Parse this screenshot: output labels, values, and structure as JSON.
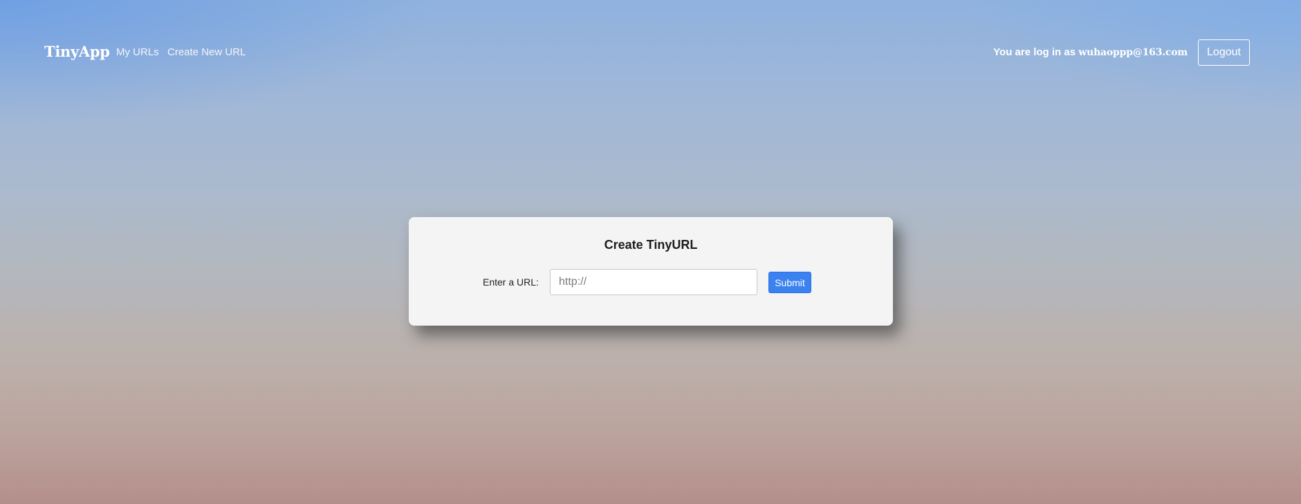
{
  "navbar": {
    "brand": "TinyApp",
    "links": [
      {
        "label": "My URLs"
      },
      {
        "label": "Create New URL"
      }
    ],
    "login_prefix": "You are log in as ",
    "user_email": "wuhaoppp@163.com",
    "logout_label": "Logout"
  },
  "form": {
    "title": "Create TinyURL",
    "url_label": "Enter a URL:",
    "url_placeholder": "http://",
    "url_value": "",
    "submit_label": "Submit"
  },
  "colors": {
    "primary_button": "#3b82f0",
    "card_background": "#f4f4f4",
    "nav_text": "#ffffff"
  }
}
